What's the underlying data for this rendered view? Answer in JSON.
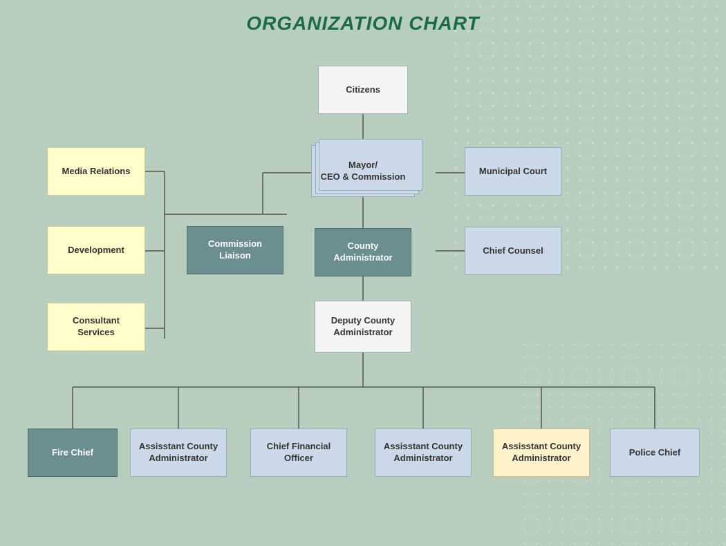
{
  "title": "ORGANIZATION CHART",
  "nodes": {
    "citizens": {
      "label": "Citizens"
    },
    "mayor": {
      "label": "Mayor/\nCEO & Commission"
    },
    "municipal_court": {
      "label": "Municipal Court"
    },
    "media_relations": {
      "label": "Media Relations"
    },
    "development": {
      "label": "Development"
    },
    "consultant_services": {
      "label": "Consultant Services"
    },
    "commission_liaison": {
      "label": "Commission\nLiaison"
    },
    "county_administrator": {
      "label": "County\nAdministrator"
    },
    "chief_counsel": {
      "label": "Chief Counsel"
    },
    "deputy_county_admin": {
      "label": "Deputy County\nAdministrator"
    },
    "fire_chief": {
      "label": "Fire Chief"
    },
    "asst_admin_1": {
      "label": "Assisstant County\nAdministrator"
    },
    "cfo": {
      "label": "Chief Financial\nOfficer"
    },
    "asst_admin_2": {
      "label": "Assisstant County\nAdministrator"
    },
    "asst_admin_3": {
      "label": "Assisstant County\nAdministrator"
    },
    "police_chief": {
      "label": "Police Chief"
    }
  }
}
